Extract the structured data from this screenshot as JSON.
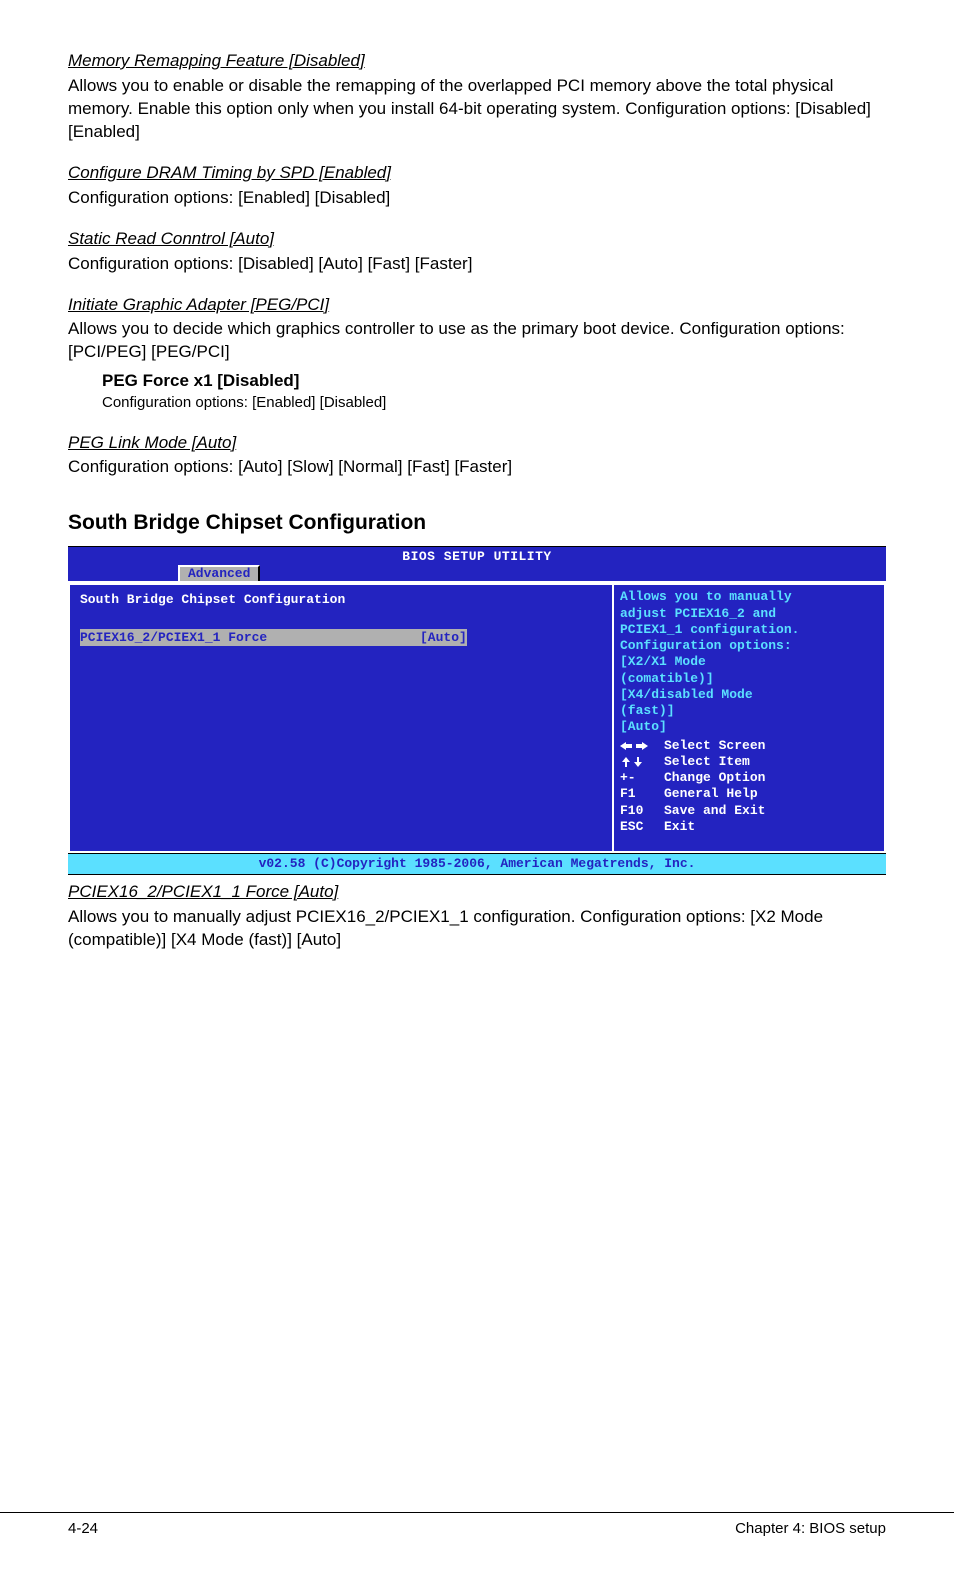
{
  "sections": {
    "mem_remap": {
      "title": "Memory Remapping Feature [Disabled]",
      "body": "Allows you to enable or disable the remapping of the overlapped PCI memory above the total physical memory. Enable this option only when you install 64-bit operating system. Configuration options: [Disabled] [Enabled]"
    },
    "dram_timing": {
      "title": "Configure DRAM Timing by SPD [Enabled]",
      "body": "Configuration options: [Enabled] [Disabled]"
    },
    "static_read": {
      "title": "Static Read Conntrol [Auto]",
      "body": "Configuration options: [Disabled] [Auto] [Fast] [Faster]"
    },
    "init_graphic": {
      "title": "Initiate Graphic Adapter [PEG/PCI]",
      "body": "Allows you to decide which graphics controller to use as the primary boot device. Configuration options: [PCI/PEG] [PEG/PCI]"
    },
    "peg_force": {
      "title": "PEG Force x1 [Disabled]",
      "body": "Configuration options: [Enabled] [Disabled]"
    },
    "peg_link": {
      "title": "PEG Link Mode [Auto]",
      "body": "Configuration options: [Auto] [Slow] [Normal] [Fast] [Faster]"
    },
    "south_bridge_heading": "South Bridge Chipset Configuration",
    "pciex_force": {
      "title": "PCIEX16_2/PCIEX1_1 Force [Auto]",
      "body": "Allows you to manually adjust PCIEX16_2/PCIEX1_1 configuration. Configuration options: [X2 Mode (compatible)] [X4 Mode (fast)] [Auto]"
    }
  },
  "bios": {
    "title": "BIOS SETUP UTILITY",
    "tab": "Advanced",
    "panel_header": "South Bridge Chipset Configuration",
    "option": {
      "label": "PCIEX16_2/PCIEX1_1 Force",
      "value": "[Auto]"
    },
    "help_lines": [
      "Allows you to manually",
      "adjust PCIEX16_2 and",
      "PCIEX1_1 configuration.",
      "Configuration options:",
      "[X2/X1 Mode",
      "(comatible)]",
      "[X4/disabled Mode",
      "(fast)]",
      "[Auto]"
    ],
    "nav": {
      "select_screen": "Select Screen",
      "select_item": "Select Item",
      "change_option": "Change Option",
      "general_help": "General Help",
      "save_exit": "Save and Exit",
      "exit": "Exit",
      "key_updown": "↑↓",
      "key_pm": "+-",
      "key_f1": "F1",
      "key_f10": "F10",
      "key_esc": "ESC"
    },
    "footer": "v02.58 (C)Copyright 1985-2006, American Megatrends, Inc."
  },
  "page_footer": {
    "left": "4-24",
    "right": "Chapter 4: BIOS setup"
  }
}
